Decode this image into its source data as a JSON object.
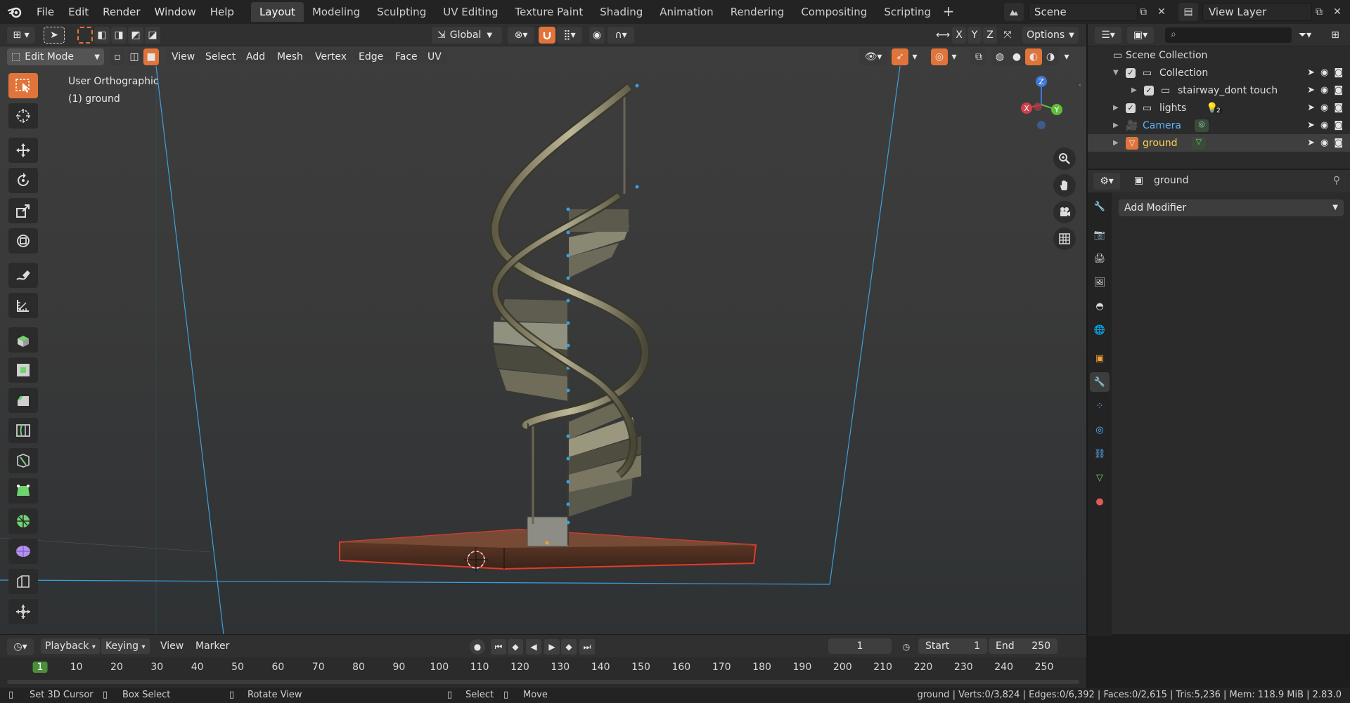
{
  "topbar": {
    "menus": [
      "File",
      "Edit",
      "Render",
      "Window",
      "Help"
    ],
    "workspaces": [
      "Layout",
      "Modeling",
      "Sculpting",
      "UV Editing",
      "Texture Paint",
      "Shading",
      "Animation",
      "Rendering",
      "Compositing",
      "Scripting"
    ],
    "active_workspace": "Layout",
    "add_workspace": "+",
    "scene": "Scene",
    "view_layer": "View Layer"
  },
  "header": {
    "orientation": "Global",
    "axes": [
      "X",
      "Y",
      "Z"
    ],
    "options": "Options"
  },
  "viewport": {
    "mode": "Edit Mode",
    "menus": [
      "View",
      "Select",
      "Add",
      "Mesh",
      "Vertex",
      "Edge",
      "Face",
      "UV"
    ],
    "view_name": "User Orthographic",
    "object_label": "(1) ground",
    "gizmo": {
      "x": "X",
      "y": "Y",
      "z": "Z"
    }
  },
  "outliner": {
    "search_placeholder": "",
    "root": "Scene Collection",
    "rows": [
      {
        "label": "Collection",
        "kind": "collection"
      },
      {
        "label": "stairway_dont touch",
        "kind": "collection"
      },
      {
        "label": "lights",
        "kind": "collection",
        "badge": "2"
      },
      {
        "label": "Camera",
        "kind": "camera"
      },
      {
        "label": "ground",
        "kind": "mesh"
      }
    ]
  },
  "properties": {
    "object_name": "ground",
    "add_modifier": "Add Modifier"
  },
  "timeline": {
    "menus": [
      "Playback",
      "Keying",
      "View",
      "Marker"
    ],
    "current_frame": "1",
    "start_label": "Start",
    "start": "1",
    "end_label": "End",
    "end": "250",
    "ticks": [
      "1",
      "10",
      "20",
      "30",
      "40",
      "50",
      "60",
      "70",
      "80",
      "90",
      "100",
      "110",
      "120",
      "130",
      "140",
      "150",
      "160",
      "170",
      "180",
      "190",
      "200",
      "210",
      "220",
      "230",
      "240",
      "250"
    ]
  },
  "status": {
    "left": [
      "Set 3D Cursor",
      "Box Select",
      "Rotate View",
      "Select",
      "Move"
    ],
    "stats": "ground | Verts:0/3,824 | Edges:0/6,392 | Faces:0/2,615 | Tris:5,236 | Mem: 118.9 MiB | 2.83.0"
  },
  "colors": {
    "accent_orange": "#e0743a",
    "selection_blue": "#4772b3",
    "camera_text": "#5ab4ff",
    "active_object_text": "#ffd34f",
    "frame_green": "#4a8f3a"
  }
}
